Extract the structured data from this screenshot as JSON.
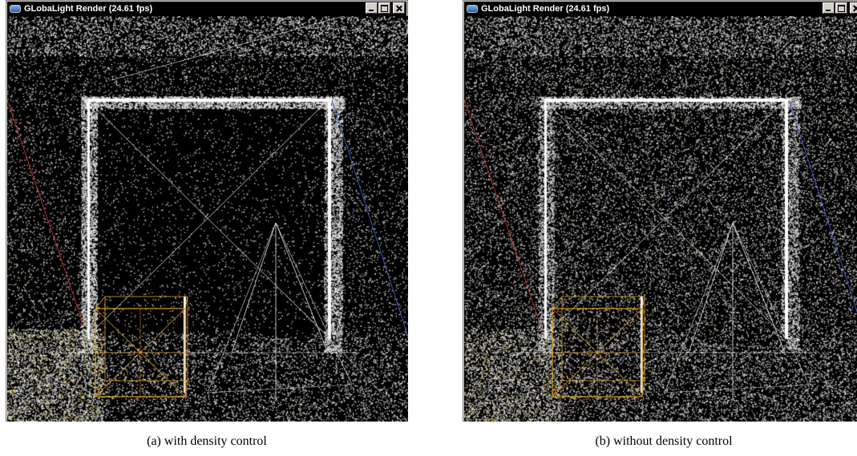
{
  "windows": [
    {
      "id": "a",
      "title": "GLobaLight Render (24.61 fps)",
      "caption": "(a)  with density control",
      "density_control": true
    },
    {
      "id": "b",
      "title": "GLobaLight Render (24.61 fps)",
      "caption": "(b)  without density control",
      "density_control": false
    }
  ],
  "icons": {
    "app": "app-window-icon",
    "minimize": "minimize-icon",
    "maximize": "maximize-icon",
    "close": "close-icon"
  },
  "colors": {
    "titlebar": "#000000",
    "title_text": "#ffffff",
    "viewport_bg": "#000000",
    "wireframe": "#d9d9d9",
    "cube_edges": "#e0a020",
    "left_light_line": "#c83232",
    "right_light_line": "#4060c8"
  }
}
